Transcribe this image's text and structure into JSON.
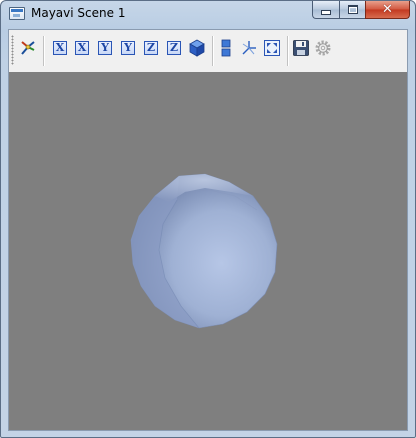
{
  "window": {
    "title": "Mayavi Scene 1",
    "close_glyph": "✕"
  },
  "toolbar": {
    "buttons": [
      {
        "name": "mayavi-pipeline-icon"
      },
      {
        "name": "view-x-minus",
        "label": "X"
      },
      {
        "name": "view-x-plus",
        "label": "X"
      },
      {
        "name": "view-y-minus",
        "label": "Y"
      },
      {
        "name": "view-y-plus",
        "label": "Y"
      },
      {
        "name": "view-z-minus",
        "label": "Z"
      },
      {
        "name": "view-z-plus",
        "label": "Z"
      },
      {
        "name": "isometric-view-icon"
      },
      {
        "name": "parallel-projection-icon"
      },
      {
        "name": "toggle-axes-icon"
      },
      {
        "name": "full-screen-icon"
      },
      {
        "name": "save-icon"
      },
      {
        "name": "configure-scene-icon"
      }
    ]
  },
  "scene": {
    "background_color": "#7f7f7f",
    "object": "sphere",
    "object_color": "#a9b9d8"
  }
}
